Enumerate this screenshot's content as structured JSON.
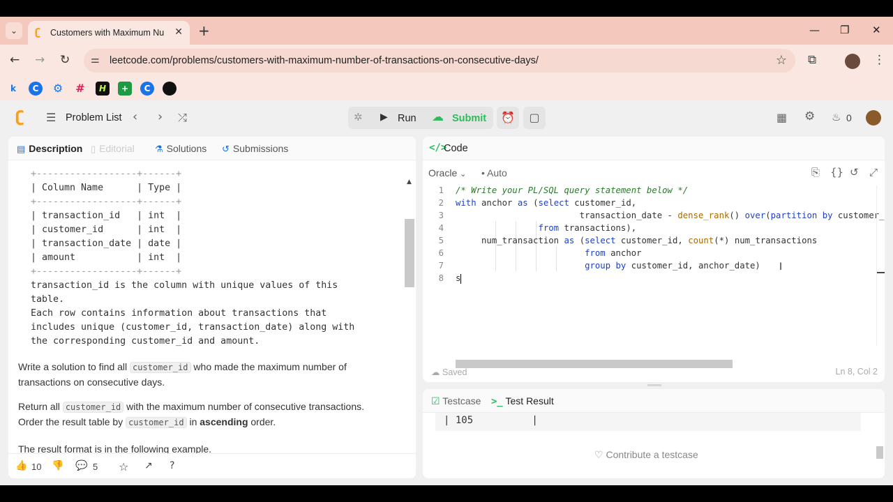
{
  "browser": {
    "tab_title": "Customers with Maximum Nu",
    "url": "leetcode.com/problems/customers-with-maximum-number-of-transactions-on-consecutive-days/",
    "bookmarks": [
      "k",
      "C",
      "⚙",
      "#",
      "H",
      "+",
      "C",
      "github"
    ]
  },
  "header": {
    "problem_list": "Problem List",
    "run": "Run",
    "submit": "Submit",
    "streak": "0"
  },
  "left_tabs": {
    "description": "Description",
    "editorial": "Editorial",
    "solutions": "Solutions",
    "submissions": "Submissions"
  },
  "description": {
    "table_lines": [
      "+------------------+------+",
      "| Column Name      | Type |",
      "+------------------+------+",
      "| transaction_id   | int  |",
      "| customer_id      | int  |",
      "| transaction_date | date |",
      "| amount           | int  |",
      "+------------------+------+",
      "transaction_id is the column with unique values of this",
      "table.",
      "Each row contains information about transactions that",
      "includes unique (customer_id, transaction_date) along with",
      "the corresponding customer_id and amount."
    ],
    "p1_a": "Write a solution to find all ",
    "p1_code": "customer_id",
    "p1_b": " who made the maximum number of transactions on consecutive days.",
    "p2_a": "Return all ",
    "p2_code": "customer_id",
    "p2_b": " with the maximum number of consecutive transactions. Order the result table by ",
    "p2_code2": "customer_id",
    "p2_c": " in ",
    "p2_bold": "ascending",
    "p2_d": " order.",
    "p3": "The result format is in the following example."
  },
  "footer": {
    "likes": "10",
    "comments": "5"
  },
  "code_panel": {
    "title": "Code",
    "language": "Oracle",
    "mode": "Auto",
    "line_numbers": [
      "1",
      "2",
      "3",
      "4",
      "5",
      "6",
      "7",
      "8"
    ],
    "saved": "Saved",
    "cursor_pos": "Ln 8, Col 2"
  },
  "test_panel": {
    "testcase": "Testcase",
    "test_result": "Test Result",
    "result_row": "| 105          |",
    "contribute": "Contribute a testcase"
  },
  "colors": {
    "accent_green": "#2cbb5d",
    "leetcode_orange": "#f89f1b",
    "tab_bar": "#f4c8bd"
  }
}
